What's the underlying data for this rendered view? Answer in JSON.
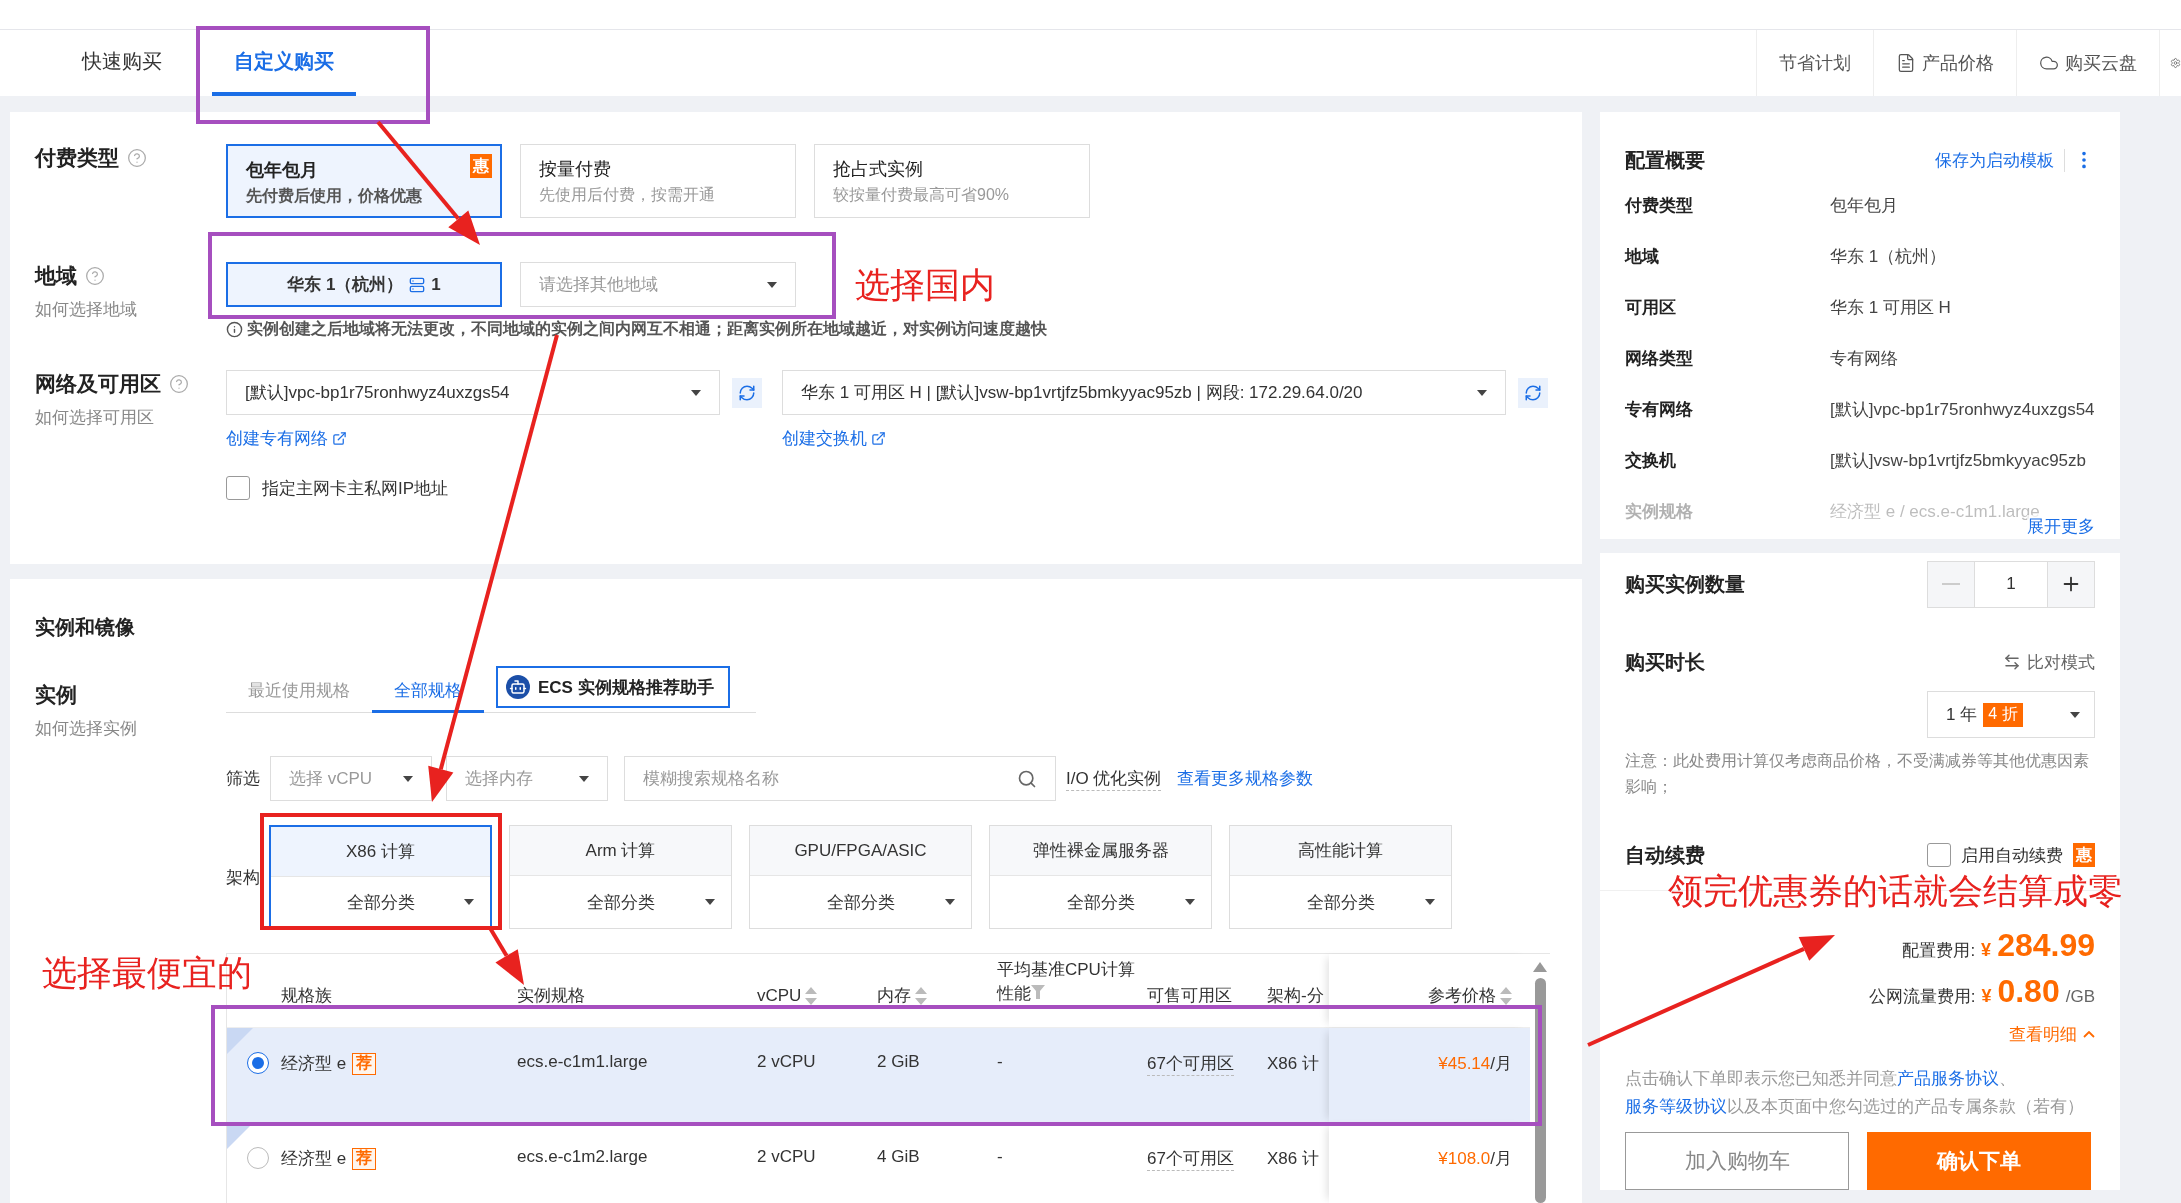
{
  "header": {
    "tabs": [
      {
        "label": "快速购买",
        "selected": false
      },
      {
        "label": "自定义购买",
        "selected": true
      }
    ],
    "links": [
      {
        "label": "节省计划",
        "kind": "plain"
      },
      {
        "label": "产品价格",
        "kind": "document"
      },
      {
        "label": "购买云盘",
        "kind": "cloud"
      }
    ]
  },
  "billing": {
    "label": "付费类型",
    "options": [
      {
        "title": "包年包月",
        "desc": "先付费后使用，价格优惠",
        "badge": "惠",
        "selected": true
      },
      {
        "title": "按量付费",
        "desc": "先使用后付费，按需开通",
        "selected": false
      },
      {
        "title": "抢占式实例",
        "desc": "较按量付费最高可省90%",
        "selected": false
      }
    ]
  },
  "region": {
    "label": "地域",
    "help": "如何选择地域",
    "selected": "华东 1（杭州）",
    "count": "1",
    "placeholder": "请选择其他地域",
    "notice": "实例创建之后地域将无法更改，不同地域的实例之间内网互不相通；距离实例所在地域越近，对实例访问速度越快"
  },
  "network": {
    "label": "网络及可用区",
    "help": "如何选择可用区",
    "vpc": "[默认]vpc-bp1r75ronhwyz4uxzgs54",
    "vswitch": "华东 1 可用区 H | [默认]vsw-bp1vrtjfz5bmkyyac95zb | 网段: 172.29.64.0/20",
    "vpc_link": "创建专有网络",
    "vswitch_link": "创建交换机",
    "ip_option": {
      "label": "指定主网卡主私网IP地址",
      "checked": false
    }
  },
  "instance": {
    "section_title": "实例和镜像",
    "label": "实例",
    "help": "如何选择实例",
    "tabs": [
      {
        "label": "最近使用规格",
        "selected": false
      },
      {
        "label": "全部规格",
        "selected": true
      }
    ],
    "assistant": "ECS 实例规格推荐助手",
    "filter": {
      "label": "筛选",
      "vcpu_placeholder": "选择 vCPU",
      "memory_placeholder": "选择内存",
      "search_placeholder": "模糊搜索规格名称",
      "io_label": "I/O 优化实例",
      "more_link": "查看更多规格参数"
    },
    "arch": {
      "label": "架构",
      "items": [
        {
          "title": "X86 计算",
          "category": "全部分类",
          "selected": true
        },
        {
          "title": "Arm 计算",
          "category": "全部分类",
          "selected": false
        },
        {
          "title": "GPU/FPGA/ASIC",
          "category": "全部分类",
          "selected": false
        },
        {
          "title": "弹性裸金属服务器",
          "category": "全部分类",
          "selected": false
        },
        {
          "title": "高性能计算",
          "category": "全部分类",
          "selected": false
        }
      ]
    },
    "table": {
      "columns": [
        {
          "label": "规格族",
          "kind": "plain"
        },
        {
          "label": "实例规格",
          "kind": "plain"
        },
        {
          "label": "vCPU",
          "kind": "sort"
        },
        {
          "label": "内存",
          "kind": "sort"
        },
        {
          "label": "平均基准CPU计算性能",
          "kind": "filter"
        },
        {
          "label": "可售可用区",
          "kind": "plain"
        },
        {
          "label": "架构-分",
          "kind": "plain"
        },
        {
          "label": "参考价格",
          "kind": "sort"
        }
      ],
      "rows": [
        {
          "family": "经济型 e",
          "badge": "荐",
          "spec": "ecs.e-c1m1.large",
          "vcpu": "2 vCPU",
          "memory": "2 GiB",
          "performance": "-",
          "zones": "67个可用区",
          "arch": "X86 计",
          "price": "¥45.14",
          "unit": "/月",
          "selected": true
        },
        {
          "family": "经济型 e",
          "badge": "荐",
          "spec": "ecs.e-c1m2.large",
          "vcpu": "2 vCPU",
          "memory": "4 GiB",
          "performance": "-",
          "zones": "67个可用区",
          "arch": "X86 计",
          "price": "¥108.0",
          "unit": "/月",
          "selected": false
        }
      ]
    }
  },
  "summary": {
    "title": "配置概要",
    "save_link": "保存为启动模板",
    "rows": [
      {
        "label": "付费类型",
        "value": "包年包月",
        "faded": false
      },
      {
        "label": "地域",
        "value": "华东 1（杭州）",
        "faded": false
      },
      {
        "label": "可用区",
        "value": "华东 1 可用区 H",
        "faded": false
      },
      {
        "label": "网络类型",
        "value": "专有网络",
        "faded": false
      },
      {
        "label": "专有网络",
        "value": "[默认]vpc-bp1r75ronhwyz4uxzgs54",
        "faded": false
      },
      {
        "label": "交换机",
        "value": "[默认]vsw-bp1vrtjfz5bmkyyac95zb",
        "faded": false
      },
      {
        "label": "实例规格",
        "value": "经济型 e / ecs.e-c1m1.large",
        "faded": true
      }
    ],
    "more_link": "展开更多"
  },
  "quantity": {
    "label": "购买实例数量",
    "value": "1"
  },
  "duration": {
    "label": "购买时长",
    "compare": "比对模式",
    "value": "1 年",
    "discount": "4 折",
    "note": "注意：此处费用计算仅考虑商品价格，不受满减券等其他优惠因素影响；"
  },
  "auto_renew": {
    "label": "自动续费",
    "option": "启用自动续费",
    "checked": false,
    "badge": "惠"
  },
  "price": {
    "config_label": "配置费用:",
    "config_currency": "¥",
    "config_value": "284.99",
    "traffic_label": "公网流量费用:",
    "traffic_currency": "¥",
    "traffic_value": "0.80",
    "traffic_unit": "/GB",
    "details": "查看明细"
  },
  "agreement": [
    {
      "text": "点击确认下单即表示您已知悉并同意",
      "link": false
    },
    {
      "text": "产品服务协议",
      "link": true
    },
    {
      "text": "、",
      "link": false
    },
    {
      "text": "服务等级协议",
      "link": true
    },
    {
      "text": "以及本页面中您勾选过的产品专属条款（若有）",
      "link": false
    }
  ],
  "buttons": {
    "cart": "加入购物车",
    "order": "确认下单"
  },
  "annotations": [
    "选择国内",
    "选择最便宜的",
    "领完优惠券的话就会结算成零"
  ]
}
